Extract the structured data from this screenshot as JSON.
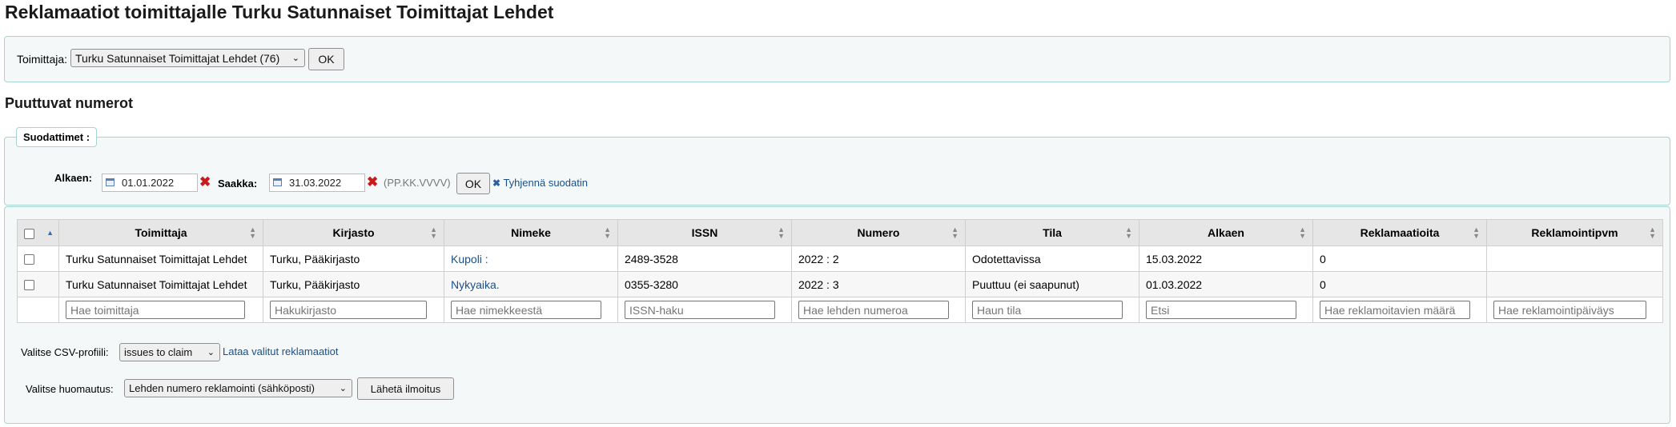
{
  "page": {
    "title": "Reklamaatiot toimittajalle Turku Satunnaiset Toimittajat Lehdet"
  },
  "vendor": {
    "label": "Toimittaja:",
    "selected": "Turku Satunnaiset Toimittajat Lehdet (76)",
    "ok_label": "OK"
  },
  "section": {
    "title": "Puuttuvat numerot"
  },
  "filters": {
    "legend": "Suodattimet :",
    "from_label": "Alkaen:",
    "from_value": "01.01.2022",
    "to_label": "Saakka:",
    "to_value": "31.03.2022",
    "date_format_hint": "(PP.KK.VVVV)",
    "ok_label": "OK",
    "clear_label": "Tyhjennä suodatin"
  },
  "table": {
    "columns": [
      "Toimittaja",
      "Kirjasto",
      "Nimeke",
      "ISSN",
      "Numero",
      "Tila",
      "Alkaen",
      "Reklamaatioita",
      "Reklamointipvm"
    ],
    "rows": [
      {
        "vendor": "Turku Satunnaiset Toimittajat Lehdet",
        "library": "Turku, Pääkirjasto",
        "title": "Kupoli :",
        "issn": "2489-3528",
        "number": "2022 : 2",
        "status": "Odotettavissa",
        "since": "15.03.2022",
        "claims_count": "0",
        "claim_date": ""
      },
      {
        "vendor": "Turku Satunnaiset Toimittajat Lehdet",
        "library": "Turku, Pääkirjasto",
        "title": "Nykyaika.",
        "issn": "0355-3280",
        "number": "2022 : 3",
        "status": "Puuttuu (ei saapunut)",
        "since": "01.03.2022",
        "claims_count": "0",
        "claim_date": ""
      }
    ],
    "filter_placeholders": [
      "Hae toimittaja",
      "Hakukirjasto",
      "Hae nimekkeestä",
      "ISSN-haku",
      "Hae lehden numeroa",
      "Haun tila",
      "Etsi",
      "Hae reklamoitavien määrä",
      "Hae reklamointipäiväys"
    ]
  },
  "csv": {
    "label": "Valitse CSV-profiili:",
    "selected": "issues to claim",
    "download_label": "Lataa valitut reklamaatiot"
  },
  "notice": {
    "label": "Valitse huomautus:",
    "selected": "Lehden numero reklamointi (sähköposti)",
    "send_label": "Lähetä ilmoitus"
  },
  "colors": {
    "box_border": "#a6d4cf",
    "box_background": "#f4f8f9",
    "link": "#1a4f8a",
    "clear_icon": "#cc1a1a"
  }
}
